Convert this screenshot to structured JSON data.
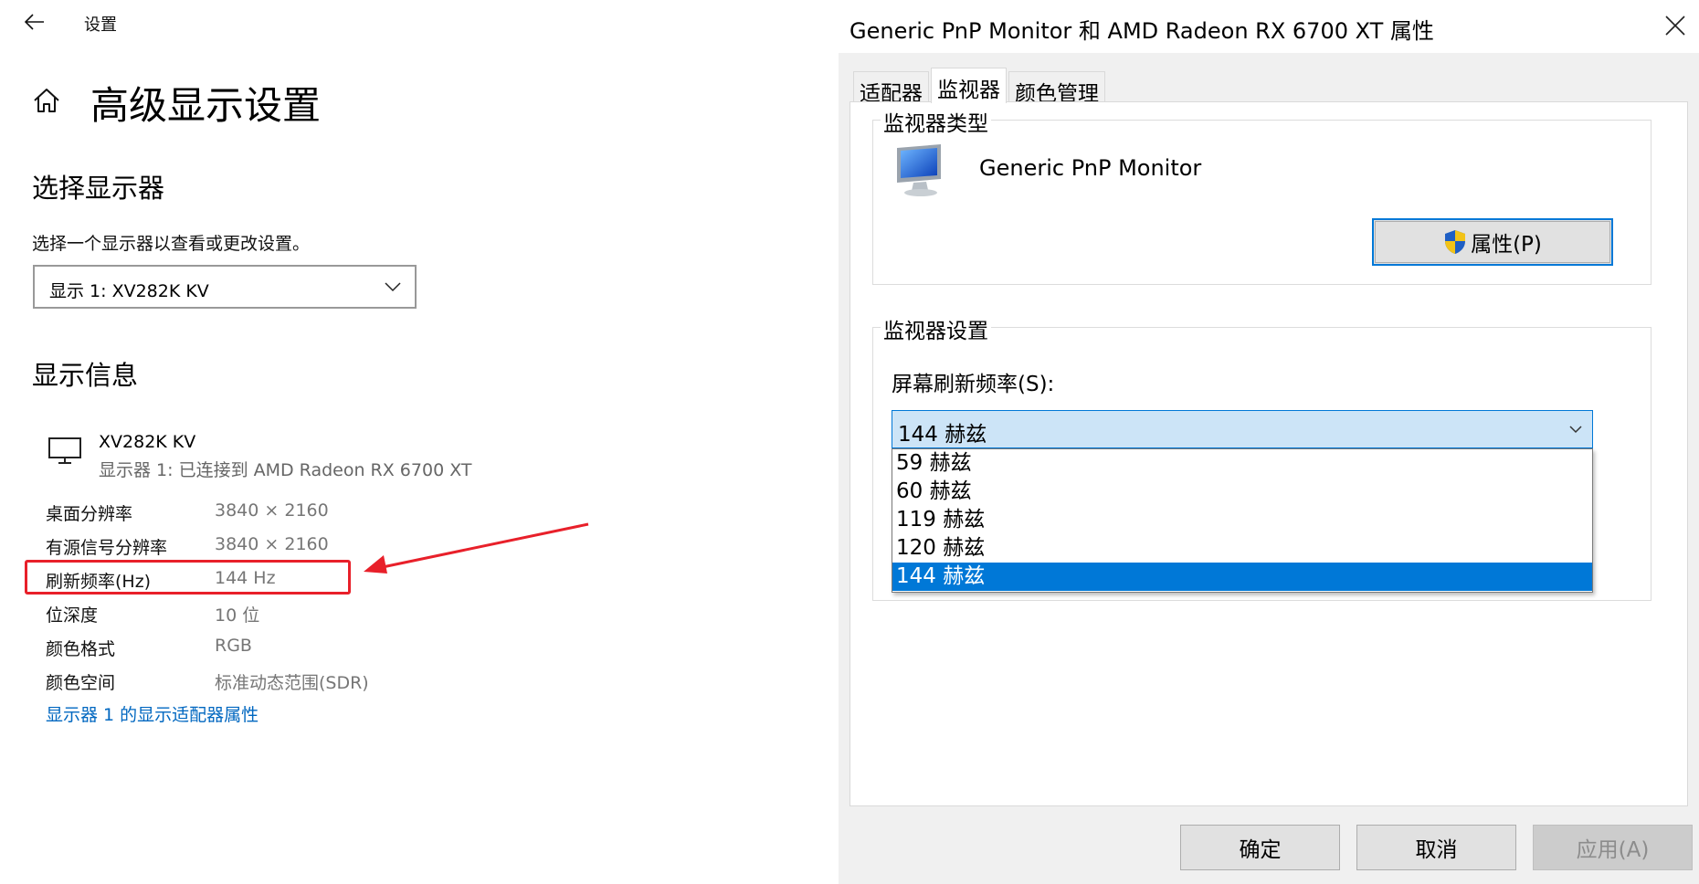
{
  "settings": {
    "app_title": "设置",
    "page_title": "高级显示设置",
    "choose_section": "选择显示器",
    "choose_desc": "选择一个显示器以查看或更改设置。",
    "display_select_value": "显示 1: XV282K KV",
    "info_section": "显示信息",
    "monitor_name": "XV282K KV",
    "monitor_sub": "显示器 1: 已连接到 AMD Radeon RX 6700 XT",
    "info_rows": [
      {
        "label": "桌面分辨率",
        "value": "3840 × 2160"
      },
      {
        "label": "有源信号分辨率",
        "value": "3840 × 2160"
      },
      {
        "label": "刷新频率(Hz)",
        "value": "144 Hz"
      },
      {
        "label": "位深度",
        "value": "10 位"
      },
      {
        "label": "颜色格式",
        "value": "RGB"
      },
      {
        "label": "颜色空间",
        "value": "标准动态范围(SDR)"
      }
    ],
    "adapter_link": "显示器 1 的显示适配器属性"
  },
  "dialog": {
    "title": "Generic PnP Monitor 和 AMD Radeon RX 6700 XT 属性",
    "tabs": [
      {
        "label": "适配器",
        "active": false
      },
      {
        "label": "监视器",
        "active": true
      },
      {
        "label": "颜色管理",
        "active": false
      }
    ],
    "monitor_type_group": "监视器类型",
    "monitor_type_name": "Generic PnP Monitor",
    "properties_button": "属性(P)",
    "monitor_settings_group": "监视器设置",
    "refresh_label": "屏幕刷新频率(S):",
    "refresh_selected": "144 赫兹",
    "refresh_options": [
      "59 赫兹",
      "60 赫兹",
      "119 赫兹",
      "120 赫兹",
      "144 赫兹"
    ],
    "buttons": {
      "ok": "确定",
      "cancel": "取消",
      "apply": "应用(A)"
    }
  },
  "colors": {
    "accent": "#0078d7",
    "link": "#0067c0",
    "highlight": "#e8202a"
  }
}
